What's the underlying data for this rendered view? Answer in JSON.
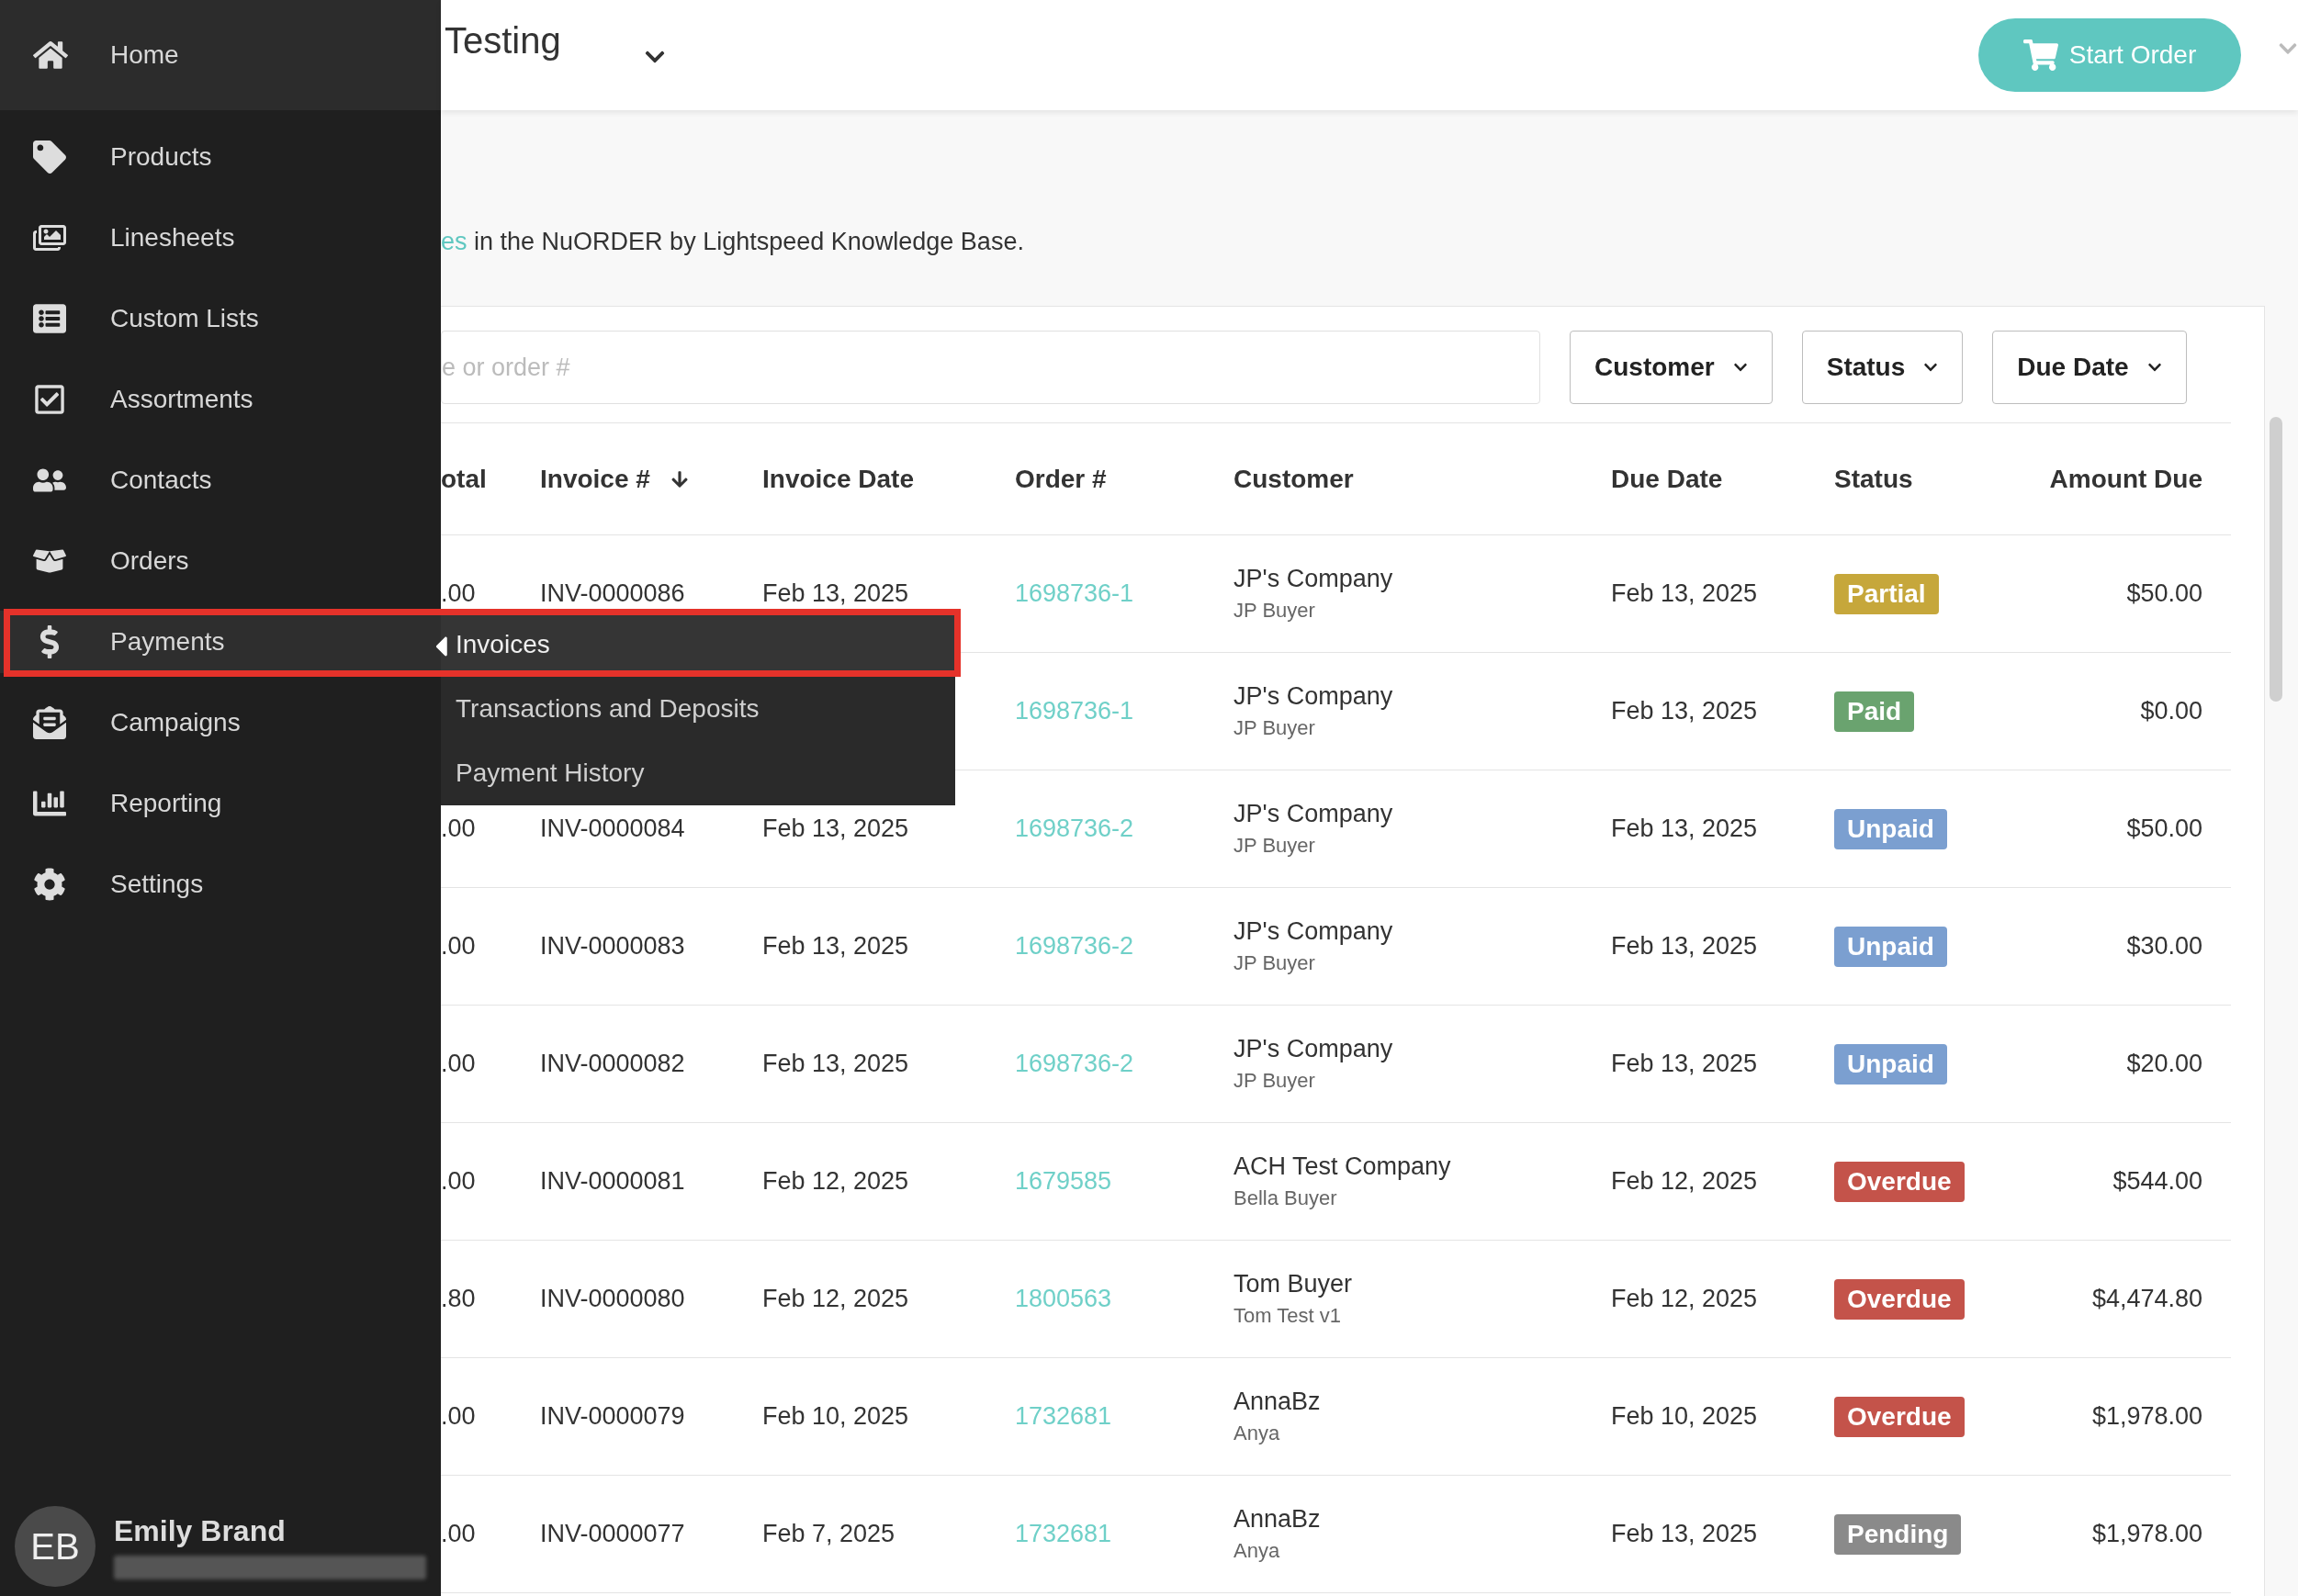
{
  "sidebar": {
    "home": {
      "label": "Home"
    },
    "items": [
      {
        "label": "Products",
        "selected": false
      },
      {
        "label": "Linesheets",
        "selected": false
      },
      {
        "label": "Custom Lists",
        "selected": false
      },
      {
        "label": "Assortments",
        "selected": false
      },
      {
        "label": "Contacts",
        "selected": false
      },
      {
        "label": "Orders",
        "selected": false
      },
      {
        "label": "Payments",
        "selected": true
      },
      {
        "label": "Campaigns",
        "selected": false
      },
      {
        "label": "Reporting",
        "selected": false
      },
      {
        "label": "Settings",
        "selected": false
      }
    ],
    "user": {
      "initials": "EB",
      "name": "Emily Brand"
    }
  },
  "submenu": {
    "items": [
      {
        "label": "Invoices",
        "selected": true
      },
      {
        "label": "Transactions and Deposits",
        "selected": false
      },
      {
        "label": "Payment History",
        "selected": false
      }
    ]
  },
  "header": {
    "title": "Testing",
    "start_order": "Start Order"
  },
  "intro": {
    "link": "es",
    "text": "in the NuORDER by Lightspeed Knowledge Base."
  },
  "search": {
    "placeholder": "e or order #"
  },
  "filters": [
    "Customer",
    "Status",
    "Due Date"
  ],
  "table": {
    "columns": [
      {
        "label": "otal",
        "sorted": false
      },
      {
        "label": "Invoice #",
        "sorted": true
      },
      {
        "label": "Invoice Date",
        "sorted": false
      },
      {
        "label": "Order #",
        "sorted": false
      },
      {
        "label": "Customer",
        "sorted": false
      },
      {
        "label": "Due Date",
        "sorted": false
      },
      {
        "label": "Status",
        "sorted": false
      },
      {
        "label": "Amount Due",
        "sorted": false
      }
    ],
    "rows": [
      {
        "total": ".00",
        "invoice": "INV-0000086",
        "invoice_date": "Feb 13, 2025",
        "order": "1698736-1",
        "customer": "JP's Company",
        "buyer": "JP Buyer",
        "due_date": "Feb 13, 2025",
        "status": {
          "label": "Partial",
          "color": "#c6a73b"
        },
        "amount": "$50.00"
      },
      {
        "order": "1698736-1",
        "customer": "JP's Company",
        "buyer": "JP Buyer",
        "due_date": "Feb 13, 2025",
        "status": {
          "label": "Paid",
          "color": "#6aa36f"
        },
        "amount": "$0.00"
      },
      {
        "total": ".00",
        "invoice": "INV-0000084",
        "invoice_date": "Feb 13, 2025",
        "order": "1698736-2",
        "customer": "JP's Company",
        "buyer": "JP Buyer",
        "due_date": "Feb 13, 2025",
        "status": {
          "label": "Unpaid",
          "color": "#7b9fd0"
        },
        "amount": "$50.00"
      },
      {
        "total": ".00",
        "invoice": "INV-0000083",
        "invoice_date": "Feb 13, 2025",
        "order": "1698736-2",
        "customer": "JP's Company",
        "buyer": "JP Buyer",
        "due_date": "Feb 13, 2025",
        "status": {
          "label": "Unpaid",
          "color": "#7b9fd0"
        },
        "amount": "$30.00"
      },
      {
        "total": ".00",
        "invoice": "INV-0000082",
        "invoice_date": "Feb 13, 2025",
        "order": "1698736-2",
        "customer": "JP's Company",
        "buyer": "JP Buyer",
        "due_date": "Feb 13, 2025",
        "status": {
          "label": "Unpaid",
          "color": "#7b9fd0"
        },
        "amount": "$20.00"
      },
      {
        "total": ".00",
        "invoice": "INV-0000081",
        "invoice_date": "Feb 12, 2025",
        "order": "1679585",
        "customer": "ACH Test Company",
        "buyer": "Bella Buyer",
        "due_date": "Feb 12, 2025",
        "status": {
          "label": "Overdue",
          "color": "#c4534a"
        },
        "amount": "$544.00"
      },
      {
        "total": ".80",
        "invoice": "INV-0000080",
        "invoice_date": "Feb 12, 2025",
        "order": "1800563",
        "customer": "Tom Buyer",
        "buyer": "Tom Test v1",
        "due_date": "Feb 12, 2025",
        "status": {
          "label": "Overdue",
          "color": "#c4534a"
        },
        "amount": "$4,474.80"
      },
      {
        "total": ".00",
        "invoice": "INV-0000079",
        "invoice_date": "Feb 10, 2025",
        "order": "1732681",
        "customer": "AnnaBz",
        "buyer": "Anya",
        "due_date": "Feb 10, 2025",
        "status": {
          "label": "Overdue",
          "color": "#c4534a"
        },
        "amount": "$1,978.00"
      },
      {
        "total": ".00",
        "invoice": "INV-0000077",
        "invoice_date": "Feb 7, 2025",
        "order": "1732681",
        "customer": "AnnaBz",
        "buyer": "Anya",
        "due_date": "Feb 13, 2025",
        "status": {
          "label": "Pending",
          "color": "#8a8a8a"
        },
        "amount": "$1,978.00"
      }
    ]
  }
}
